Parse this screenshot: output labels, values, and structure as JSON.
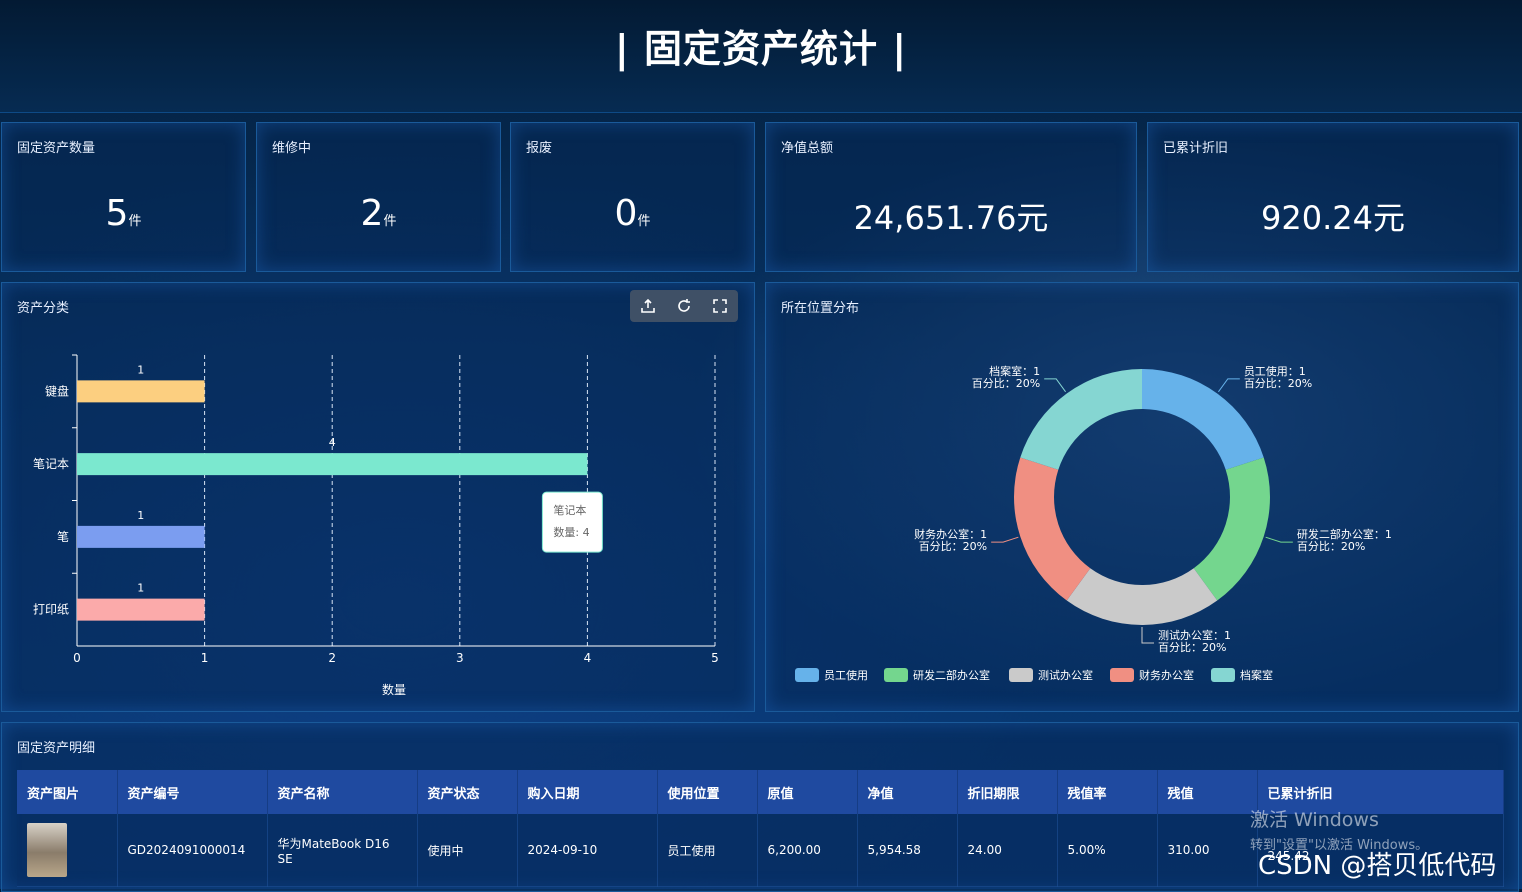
{
  "header": {
    "title": "| 固定资产统计 |"
  },
  "stats": [
    {
      "label": "固定资产数量",
      "value": "5",
      "unit": "件"
    },
    {
      "label": "维修中",
      "value": "2",
      "unit": "件"
    },
    {
      "label": "报废",
      "value": "0",
      "unit": "件"
    },
    {
      "label": "净值总额",
      "value": "24,651.76元",
      "unit": ""
    },
    {
      "label": "已累计折旧",
      "value": "920.24元",
      "unit": ""
    }
  ],
  "toolbox_icons": [
    "export-icon",
    "refresh-icon",
    "fullscreen-icon"
  ],
  "chart_data": [
    {
      "type": "bar",
      "orientation": "horizontal",
      "title": "资产分类",
      "categories": [
        "键盘",
        "笔记本",
        "笔",
        "打印纸"
      ],
      "values": [
        1,
        4,
        1,
        1
      ],
      "colors": [
        "#fccf80",
        "#7be8cf",
        "#7b9df0",
        "#fbaaaa"
      ],
      "xlabel": "数量",
      "xlim": [
        0,
        5
      ],
      "xticks": [
        "0",
        "1",
        "2",
        "3",
        "4",
        "5"
      ],
      "data_labels": [
        "1",
        "4",
        "1",
        "1"
      ],
      "grid": "dashed vertical",
      "tooltip": {
        "title": "笔记本",
        "text": "数量: 4"
      }
    },
    {
      "type": "pie",
      "variant": "donut",
      "title": "所在位置分布",
      "labels": [
        "员工使用",
        "研发二部办公室",
        "测试办公室",
        "财务办公室",
        "档案室"
      ],
      "values": [
        1,
        1,
        1,
        1,
        1
      ],
      "colors": [
        "#66b2ea",
        "#74d68e",
        "#cacaca",
        "#f08f82",
        "#85d6d2"
      ],
      "callouts": [
        {
          "line1": "员工使用：1",
          "line2": "百分比：20%"
        },
        {
          "line1": "研发二部办公室：1",
          "line2": "百分比：20%"
        },
        {
          "line1": "测试办公室：1",
          "line2": "百分比：20%"
        },
        {
          "line1": "财务办公室：1",
          "line2": "百分比：20%"
        },
        {
          "line1": "档案室：1",
          "line2": "百分比：20%"
        }
      ],
      "legend": "bottom-left"
    }
  ],
  "table": {
    "title": "固定资产明细",
    "headers": [
      "资产图片",
      "资产编号",
      "资产名称",
      "资产状态",
      "购入日期",
      "使用位置",
      "原值",
      "净值",
      "折旧期限",
      "残值率",
      "残值",
      "已累计折旧"
    ],
    "rows": [
      [
        "",
        "GD2024091000014",
        "华为MateBook D16 SE",
        "使用中",
        "2024-09-10",
        "员工使用",
        "6,200.00",
        "5,954.58",
        "24.00",
        "5.00%",
        "310.00",
        "245.42"
      ]
    ]
  },
  "watermark": {
    "line1": "激活 Windows",
    "line2": "转到\"设置\"以激活 Windows。"
  },
  "csdn": "CSDN @搭贝低代码"
}
